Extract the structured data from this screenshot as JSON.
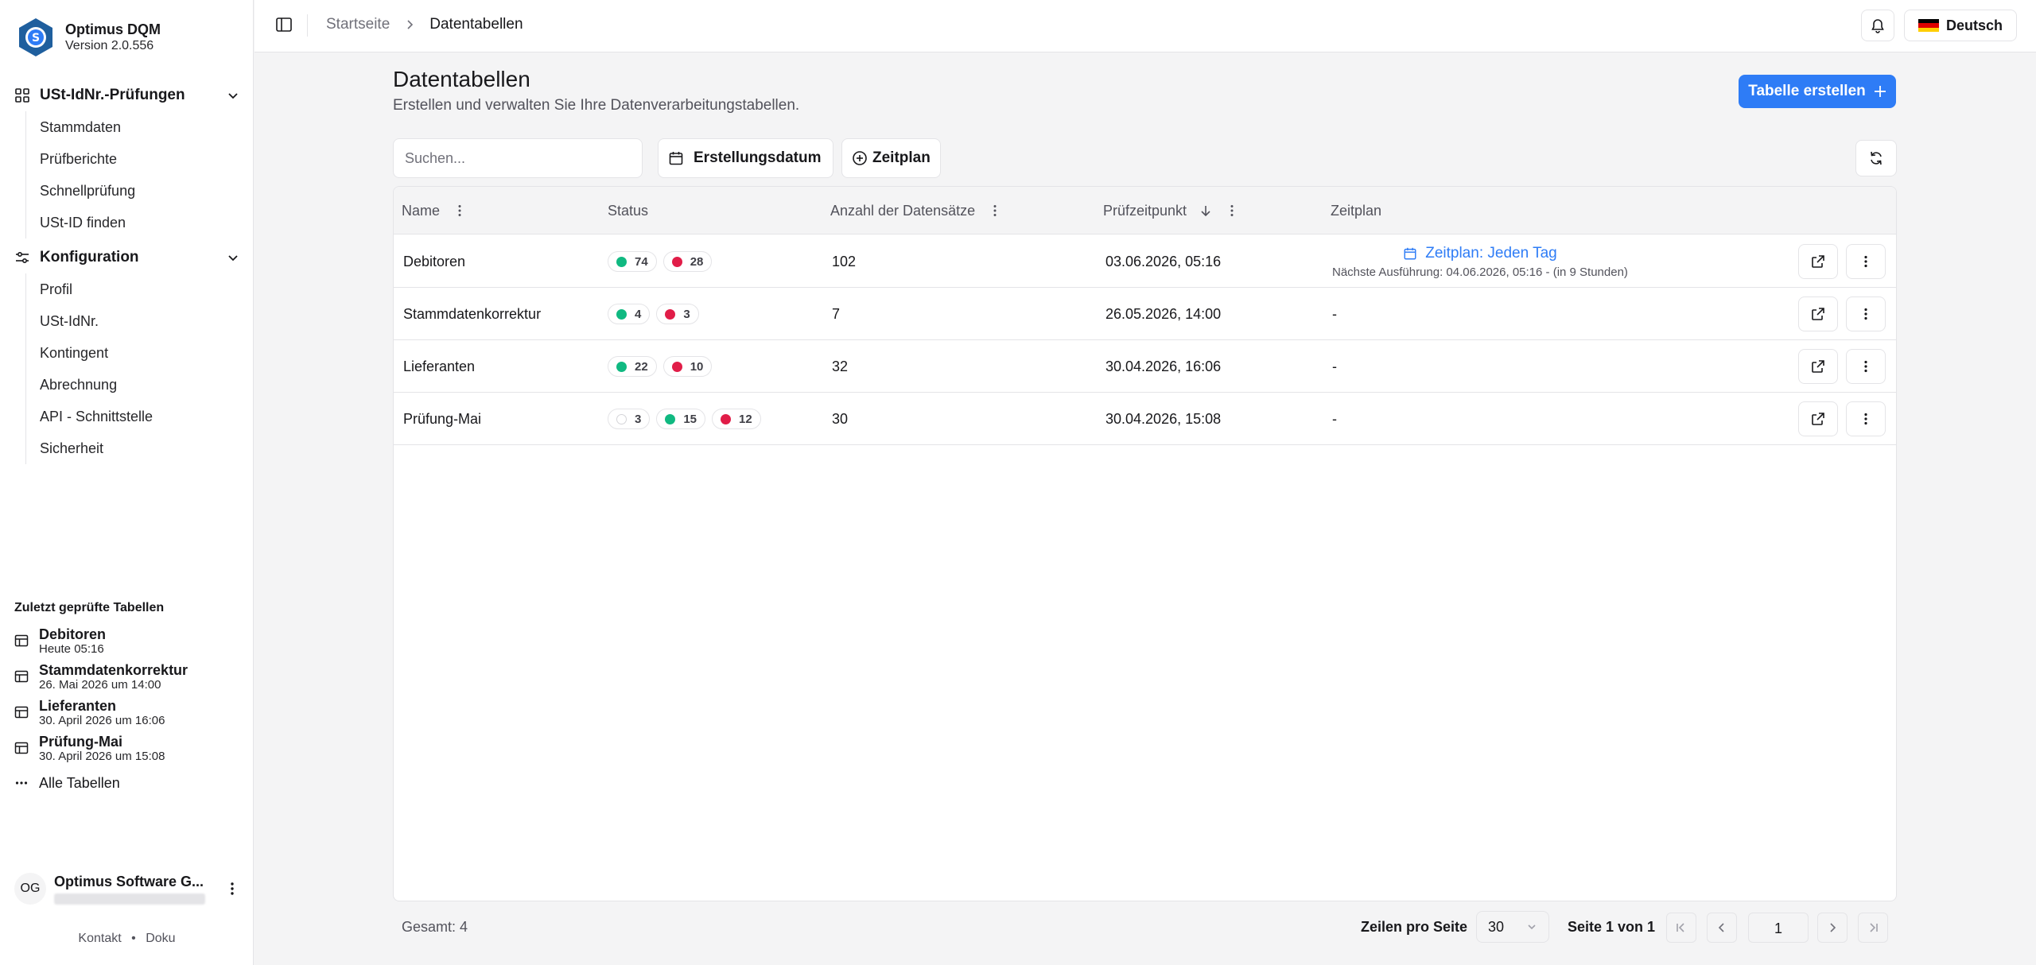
{
  "app": {
    "name": "Optimus DQM",
    "version": "Version 2.0.556"
  },
  "sidebar": {
    "group1": {
      "label": "USt-IdNr.-Prüfungen",
      "items": [
        "Stammdaten",
        "Prüfberichte",
        "Schnellprüfung",
        "USt-ID finden"
      ]
    },
    "group2": {
      "label": "Konfiguration",
      "items": [
        "Profil",
        "USt-IdNr.",
        "Kontingent",
        "Abrechnung",
        "API - Schnittstelle",
        "Sicherheit"
      ]
    },
    "recent": {
      "title": "Zuletzt geprüfte Tabellen",
      "items": [
        {
          "name": "Debitoren",
          "date": "Heute 05:16"
        },
        {
          "name": "Stammdatenkorrektur",
          "date": "26. Mai 2026 um 14:00"
        },
        {
          "name": "Lieferanten",
          "date": "30. April 2026 um 16:06"
        },
        {
          "name": "Prüfung-Mai",
          "date": "30. April 2026 um 15:08"
        }
      ],
      "all": "Alle Tabellen"
    },
    "user": {
      "initials": "OG",
      "name": "Optimus Software G..."
    },
    "footer": {
      "contact": "Kontakt",
      "sep": "•",
      "docs": "Doku"
    }
  },
  "topbar": {
    "breadcrumb_home": "Startseite",
    "breadcrumb_current": "Datentabellen",
    "language": "Deutsch"
  },
  "page": {
    "title": "Datentabellen",
    "subtitle": "Erstellen und verwalten Sie Ihre Datenverarbeitungstabellen.",
    "create_button": "Tabelle erstellen",
    "search_placeholder": "Suchen...",
    "filter_date": "Erstellungsdatum",
    "filter_schedule": "Zeitplan"
  },
  "table": {
    "columns": [
      "Name",
      "Status",
      "Anzahl der Datensätze",
      "Prüfzeitpunkt",
      "Zeitplan"
    ],
    "rows": [
      {
        "name": "Debitoren",
        "status": [
          {
            "color": "green",
            "count": "74"
          },
          {
            "color": "red",
            "count": "28"
          }
        ],
        "records": "102",
        "checked": "03.06.2026, 05:16",
        "schedule": "Zeitplan: Jeden Tag",
        "next": "Nächste Ausführung: 04.06.2026, 05:16 - (in 9 Stunden)"
      },
      {
        "name": "Stammdatenkorrektur",
        "status": [
          {
            "color": "green",
            "count": "4"
          },
          {
            "color": "red",
            "count": "3"
          }
        ],
        "records": "7",
        "checked": "26.05.2026, 14:00",
        "schedule": "-"
      },
      {
        "name": "Lieferanten",
        "status": [
          {
            "color": "green",
            "count": "22"
          },
          {
            "color": "red",
            "count": "10"
          }
        ],
        "records": "32",
        "checked": "30.04.2026, 16:06",
        "schedule": "-"
      },
      {
        "name": "Prüfung-Mai",
        "status": [
          {
            "color": "empty",
            "count": "3"
          },
          {
            "color": "green",
            "count": "15"
          },
          {
            "color": "red",
            "count": "12"
          }
        ],
        "records": "30",
        "checked": "30.04.2026, 15:08",
        "schedule": "-"
      }
    ]
  },
  "footer": {
    "total": "Gesamt: 4",
    "rows_per_page_label": "Zeilen pro Seite",
    "rows_per_page": "30",
    "page_info": "Seite 1 von 1",
    "page_input": "1"
  },
  "colors": {
    "primary": "#2e7cf6",
    "green": "#10b981",
    "red": "#e11d48",
    "border": "#e4e4e7",
    "background": "#f4f4f5"
  }
}
